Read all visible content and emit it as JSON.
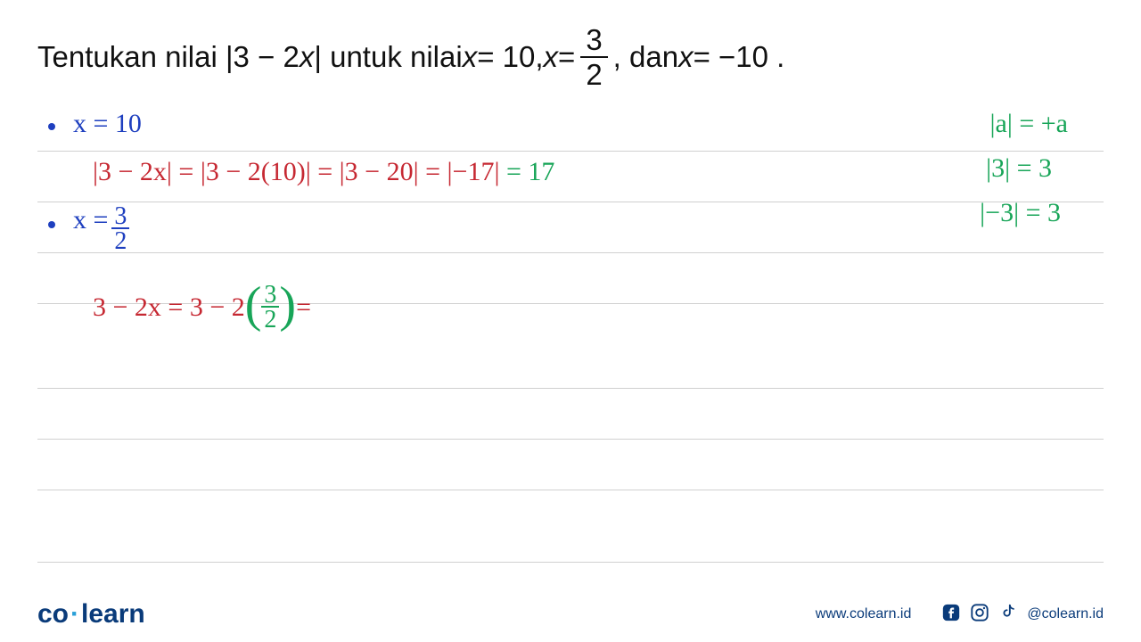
{
  "problem": {
    "t1": "Tentukan nilai |3 − 2",
    "xvar1": "x",
    "t2": "| untuk nilai ",
    "xvar2": "x",
    "t3": " = 10, ",
    "xvar3": "x",
    "t4": " = ",
    "frac_num": "3",
    "frac_den": "2",
    "t5": " , dan ",
    "xvar4": "x",
    "t6": " = −10 ."
  },
  "work": {
    "case1_label": "x = 10",
    "case1_solution_red": "|3 − 2x| = |3 − 2(10)| = |3 − 20| = |−17|",
    "case1_solution_green": " = 17",
    "case2_label_prefix": "x = ",
    "case2_frac_num": "3",
    "case2_frac_den": "2",
    "case3_red_prefix": "3 − 2x = 3 − 2",
    "case3_green_frac_num": "3",
    "case3_green_frac_den": "2",
    "case3_red_suffix": " ="
  },
  "sidebar": {
    "rule1": "|a| = +a",
    "rule2": "|3| = 3",
    "rule3": "|−3| = 3"
  },
  "footer": {
    "brand_co": "co",
    "brand_learn": "learn",
    "url": "www.colearn.id",
    "handle": "@colearn.id"
  }
}
